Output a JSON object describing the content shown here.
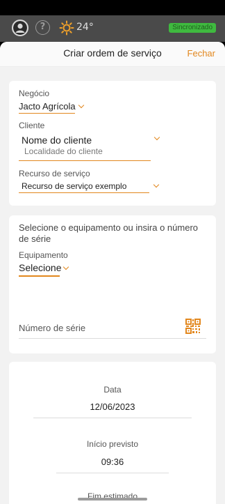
{
  "header": {
    "temperature": "24°",
    "sync_status": "Sincronizado",
    "icons": [
      "user-icon",
      "help-icon",
      "sun-icon"
    ]
  },
  "sheet": {
    "title": "Criar ordem de serviço",
    "close_label": "Fechar"
  },
  "business": {
    "label": "Negócio",
    "value": "Jacto Agrícola"
  },
  "client": {
    "label": "Cliente",
    "name": "Nome do cliente",
    "location": "Localidade do cliente"
  },
  "service_resource": {
    "label": "Recurso de serviço",
    "value": "Recurso de serviço exemplo"
  },
  "equipment_section": {
    "instruction": "Selecione o equipamento ou insira o número de série",
    "equipment_label": "Equipamento",
    "equipment_value": "Selecione",
    "serial_placeholder": "Número de série"
  },
  "schedule": {
    "date_label": "Data",
    "date_value": "12/06/2023",
    "start_label": "Início previsto",
    "start_value": "09:36",
    "end_label": "Fim estimado"
  },
  "colors": {
    "accent": "#e2871d",
    "sync_badge": "#3fb93f",
    "header_bg": "#4a4a4a"
  }
}
